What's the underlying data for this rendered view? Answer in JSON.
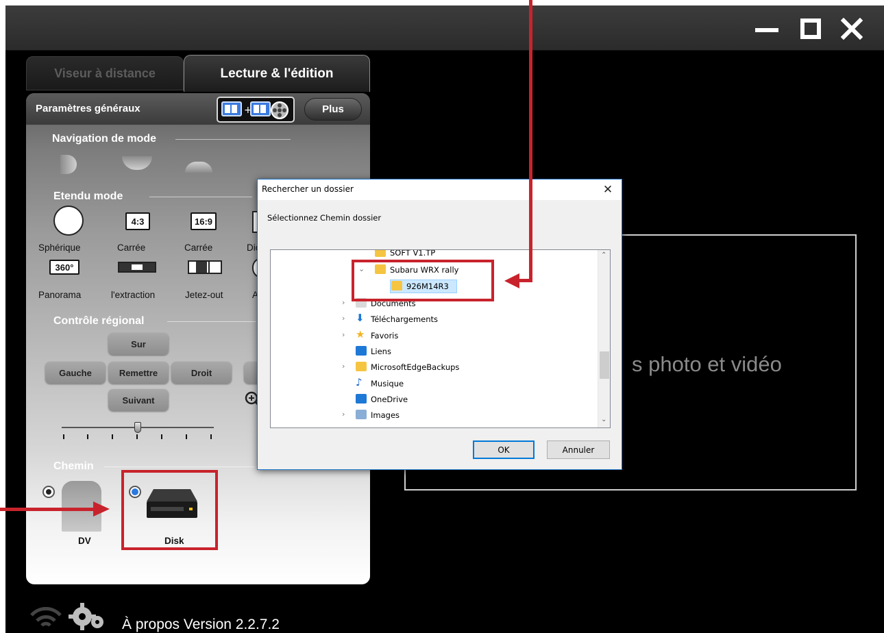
{
  "app": {
    "title_controls": [
      "minimize",
      "maximize",
      "close"
    ],
    "tabs": [
      {
        "label": "Viseur à distance",
        "active": false
      },
      {
        "label": "Lecture & l'édition",
        "active": true
      }
    ],
    "panel": {
      "title": "Paramètres généraux",
      "plus_label": "Plus",
      "merge_icon": "merge-clips-icon",
      "sections": {
        "navigation": "Navigation de mode",
        "etendu": "Etendu mode",
        "regional": "Contrôle régional",
        "chemin": "Chemin"
      },
      "modes_row1": [
        {
          "label": "Sphérique",
          "badge": ""
        },
        {
          "label": "Carrée",
          "badge": "4:3"
        },
        {
          "label": "Carrée",
          "badge": "16:9"
        },
        {
          "label": "Dich",
          "badge": ""
        }
      ],
      "modes_row2": [
        {
          "label": "Panorama",
          "badge": "360°"
        },
        {
          "label": "l'extraction",
          "badge": ""
        },
        {
          "label": "Jetez-out",
          "badge": ""
        },
        {
          "label": "Ar",
          "badge": ""
        }
      ],
      "regional_buttons": {
        "up": "Sur",
        "left": "Gauche",
        "reset": "Remettre",
        "right": "Droit",
        "down": "Suivant"
      },
      "slider_value": 0.5,
      "path_options": [
        {
          "label": "DV",
          "selected": false
        },
        {
          "label": "Disk",
          "selected": true
        }
      ]
    },
    "footer": {
      "about_text": "À propos Version 2.2.7.2"
    },
    "preview": {
      "text": "s photo et vidéo"
    }
  },
  "dialog": {
    "title": "Rechercher un dossier",
    "close": "✕",
    "instruction": "Sélectionnez Chemin dossier",
    "tree": [
      {
        "label": "SOFT V1.TP",
        "expander": "",
        "icon": "folder-icon"
      },
      {
        "label": "Subaru WRX rally",
        "expander": "⌄",
        "icon": "folder-icon"
      },
      {
        "label": "926M14R3",
        "expander": "",
        "icon": "folder-icon",
        "selected": true
      },
      {
        "label": "Documents",
        "expander": "›",
        "icon": "documents-icon"
      },
      {
        "label": "Téléchargements",
        "expander": "›",
        "icon": "download-icon"
      },
      {
        "label": "Favoris",
        "expander": "›",
        "icon": "star-icon"
      },
      {
        "label": "Liens",
        "expander": "",
        "icon": "link-icon"
      },
      {
        "label": "MicrosoftEdgeBackups",
        "expander": "›",
        "icon": "folder-icon"
      },
      {
        "label": "Musique",
        "expander": "",
        "icon": "music-icon"
      },
      {
        "label": "OneDrive",
        "expander": "",
        "icon": "cloud-icon"
      },
      {
        "label": "Images",
        "expander": "›",
        "icon": "images-icon"
      }
    ],
    "ok_label": "OK",
    "cancel_label": "Annuler"
  },
  "colors": {
    "annotation_red": "#c8232c",
    "selection_blue": "#cce8ff",
    "dialog_border": "#1a73c9"
  }
}
